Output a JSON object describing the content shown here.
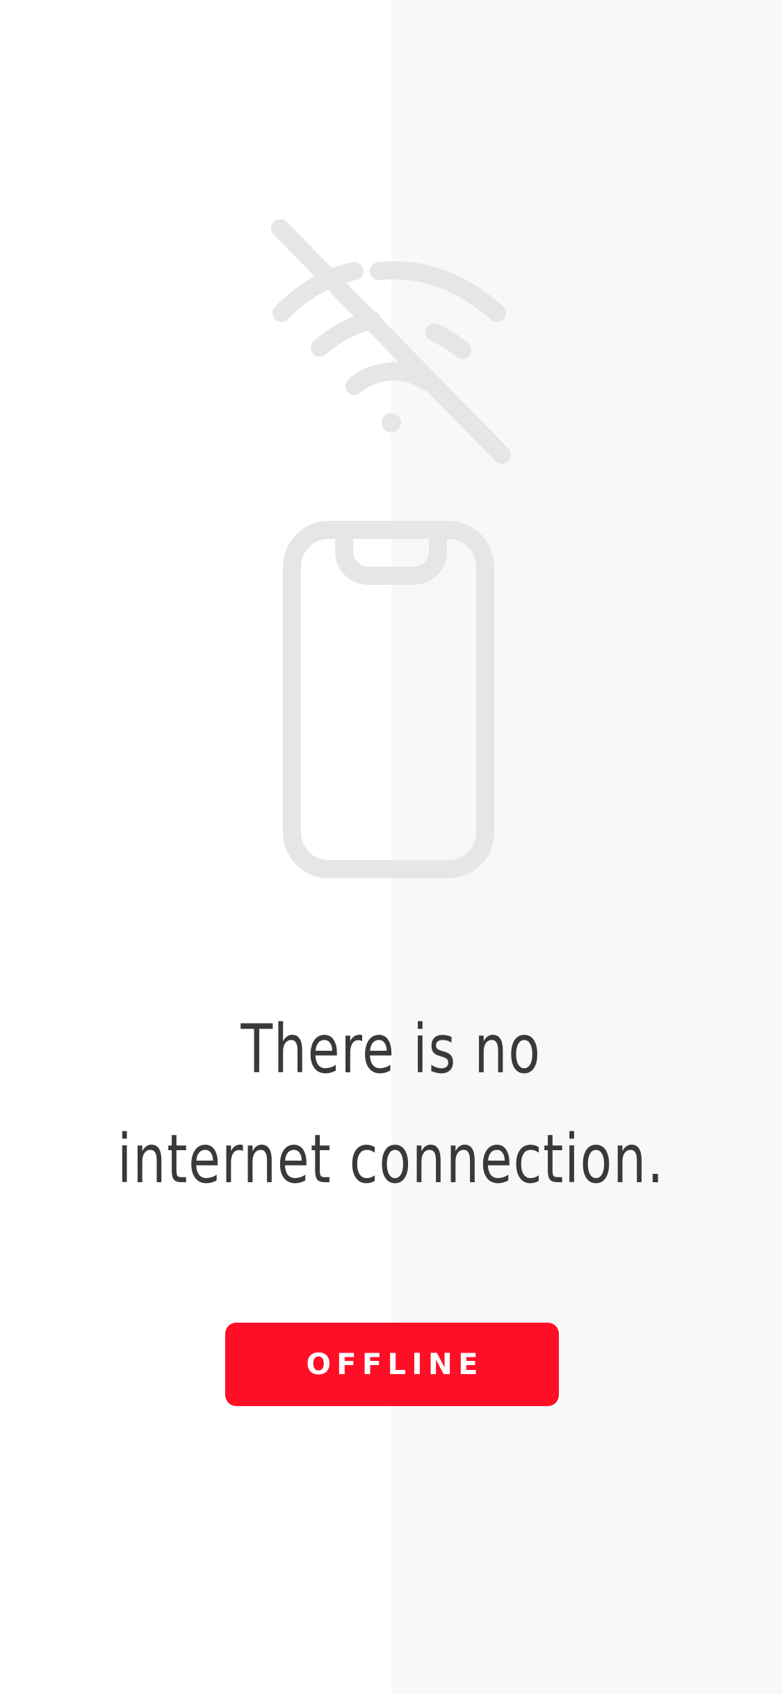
{
  "screen": {
    "background_left": "#ffffff",
    "background_right": "#f8f8f8"
  },
  "illustration": {
    "wifi_icon": "wifi-off-icon",
    "phone_icon": "smartphone-outline-icon",
    "icon_color": "#e6e6e6"
  },
  "message": {
    "line1": "There is no",
    "line2": "internet connection.",
    "color": "#393939"
  },
  "status_button": {
    "label": "OFFLINE",
    "background": "#ff0f26",
    "text_color": "#ffffff"
  }
}
